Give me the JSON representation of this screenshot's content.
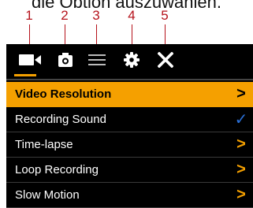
{
  "caption": "die Option auszuwählen.",
  "callouts": [
    "1",
    "2",
    "3",
    "4",
    "5"
  ],
  "tabs": [
    {
      "icon": "video-camera-icon",
      "active": true
    },
    {
      "icon": "photo-camera-icon",
      "active": false
    },
    {
      "icon": "menu-icon",
      "active": false
    },
    {
      "icon": "gear-icon",
      "active": false
    },
    {
      "icon": "close-icon",
      "active": false
    }
  ],
  "menu": {
    "items": [
      {
        "label": "Video Resolution",
        "indicator": ">",
        "selected": true
      },
      {
        "label": "Recording Sound",
        "indicator": "✓",
        "selected": false
      },
      {
        "label": "Time-lapse",
        "indicator": ">",
        "selected": false
      },
      {
        "label": "Loop Recording",
        "indicator": ">",
        "selected": false
      },
      {
        "label": "Slow Motion",
        "indicator": ">",
        "selected": false
      }
    ]
  },
  "colors": {
    "accent": "#f5a000",
    "background": "#000000",
    "check": "#2a6fd6",
    "callout": "#b5121b"
  }
}
